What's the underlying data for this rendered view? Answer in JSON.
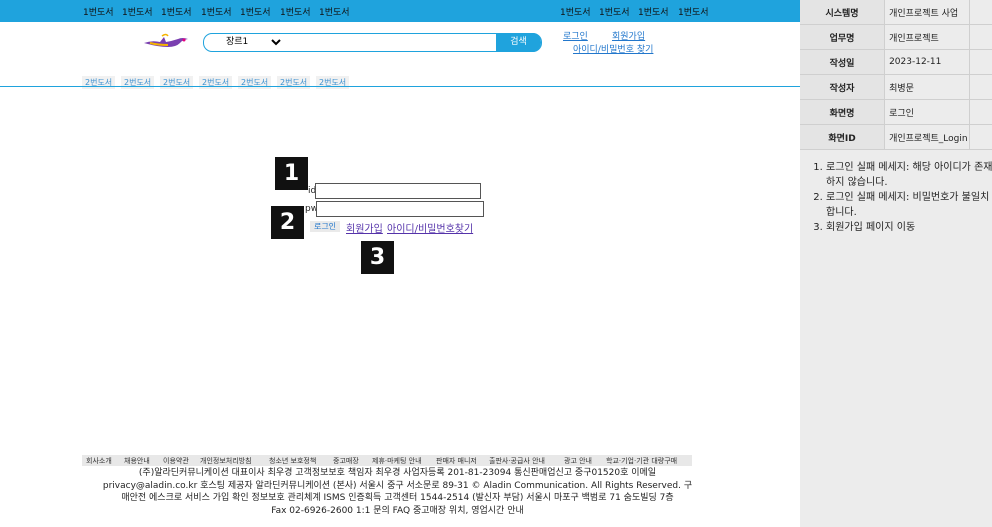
{
  "header": {
    "nav_left": [
      "1번도서",
      "1번도서",
      "1번도서",
      "1번도서",
      "1번도서",
      "1번도서",
      "1번도서"
    ],
    "nav_right": [
      "1번도서",
      "1번도서",
      "1번도서",
      "1번도서"
    ],
    "search": {
      "genre_value": "장르1",
      "button_label": "검색"
    },
    "links": {
      "login": "로그인",
      "signup": "회원가입",
      "find_account": "아이디/비밀번호 찾기"
    },
    "categories": [
      "2번도서",
      "2번도서",
      "2번도서",
      "2번도서",
      "2번도서",
      "2번도서",
      "2번도서"
    ]
  },
  "login_form": {
    "id_label": "id",
    "pw_label": "pw",
    "id_value": "",
    "pw_value": "",
    "login_button": "로그인",
    "signup_link": "회원가입",
    "find_link": "아이디/비밀번호찾기"
  },
  "badges": [
    "1",
    "2",
    "3"
  ],
  "footer": {
    "links": [
      "회사소개",
      "채용안내",
      "이용약관",
      "개인정보처리방침",
      "청소년 보호정책",
      "중고매장",
      "제휴·마케팅 안내",
      "판매자 매니저",
      "출판사·공급사 안내",
      "광고 안내",
      "학교·기업·기관 대량구매"
    ],
    "lines": [
      "(주)알라딘커뮤니케이션 대표이사 최우경 고객정보보호 책임자 최우경 사업자등록 201-81-23094 통신판매업신고 중구01520호 이메일",
      "privacy@aladin.co.kr 호스팅 제공자 알라딘커뮤니케이션 (본사) 서울시 중구 서소문로 89-31 © Aladin Communication. All Rights Reserved. 구",
      "매안전 에스크로 서비스 가입 확인 정보보호 관리체계 ISMS 인증획득 고객센터 1544-2514 (발신자 부담) 서울시 마포구 백범로 71 숨도빌딩 7층",
      "Fax 02-6926-2600 1:1 문의 FAQ 중고매장 위치, 영업시간 안내"
    ]
  },
  "spec": {
    "rows": [
      {
        "key": "시스템명",
        "value": "개인프로젝트 사업"
      },
      {
        "key": "업무명",
        "value": "개인프로젝트"
      },
      {
        "key": "작성일",
        "value": "2023-12-11"
      },
      {
        "key": "작성자",
        "value": "최병문"
      },
      {
        "key": "화면명",
        "value": "로그인"
      },
      {
        "key": "화면ID",
        "value": "개인프로젝트_Login"
      }
    ],
    "notes": [
      "로그인 실패 메세지: 해당 아이디가 존재하지 않습니다.",
      "로그인 실패 메세지: 비밀번호가 불일치 합니다.",
      "회원가입 페이지 이동"
    ]
  },
  "colors": {
    "brand_blue": "#1fa3dd",
    "panel_gray": "#ececec"
  }
}
